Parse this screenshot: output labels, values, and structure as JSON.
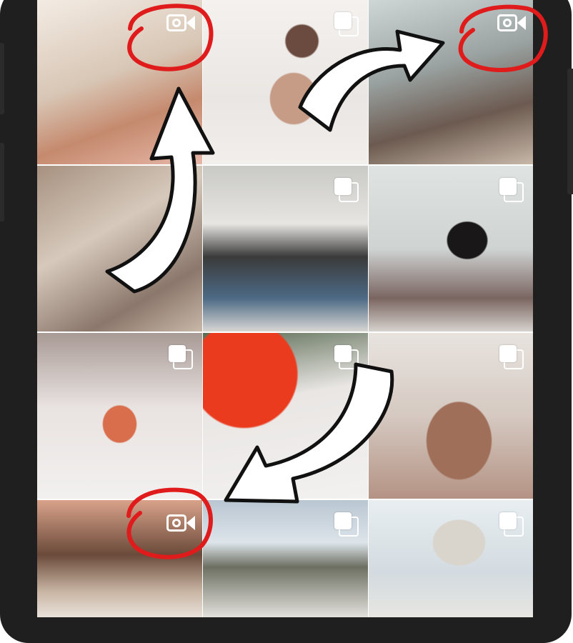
{
  "grid": {
    "tiles": [
      {
        "id": 1,
        "badge": "video-icon"
      },
      {
        "id": 2,
        "badge": "multiple-photos-icon"
      },
      {
        "id": 3,
        "badge": "video-icon"
      },
      {
        "id": 4,
        "badge": "none"
      },
      {
        "id": 5,
        "badge": "multiple-photos-icon"
      },
      {
        "id": 6,
        "badge": "multiple-photos-icon"
      },
      {
        "id": 7,
        "badge": "multiple-photos-icon"
      },
      {
        "id": 8,
        "badge": "multiple-photos-icon"
      },
      {
        "id": 9,
        "badge": "multiple-photos-icon"
      },
      {
        "id": 10,
        "badge": "video-icon"
      },
      {
        "id": 11,
        "badge": "multiple-photos-icon"
      },
      {
        "id": 12,
        "badge": "multiple-photos-icon"
      }
    ]
  },
  "annotations": {
    "circle_color": "#e01b1b",
    "arrow_fill": "#ffffff",
    "arrow_stroke": "#111111"
  },
  "colors": {
    "phone_frame": "#1f1f1f",
    "screen_background": "#ffffff"
  }
}
